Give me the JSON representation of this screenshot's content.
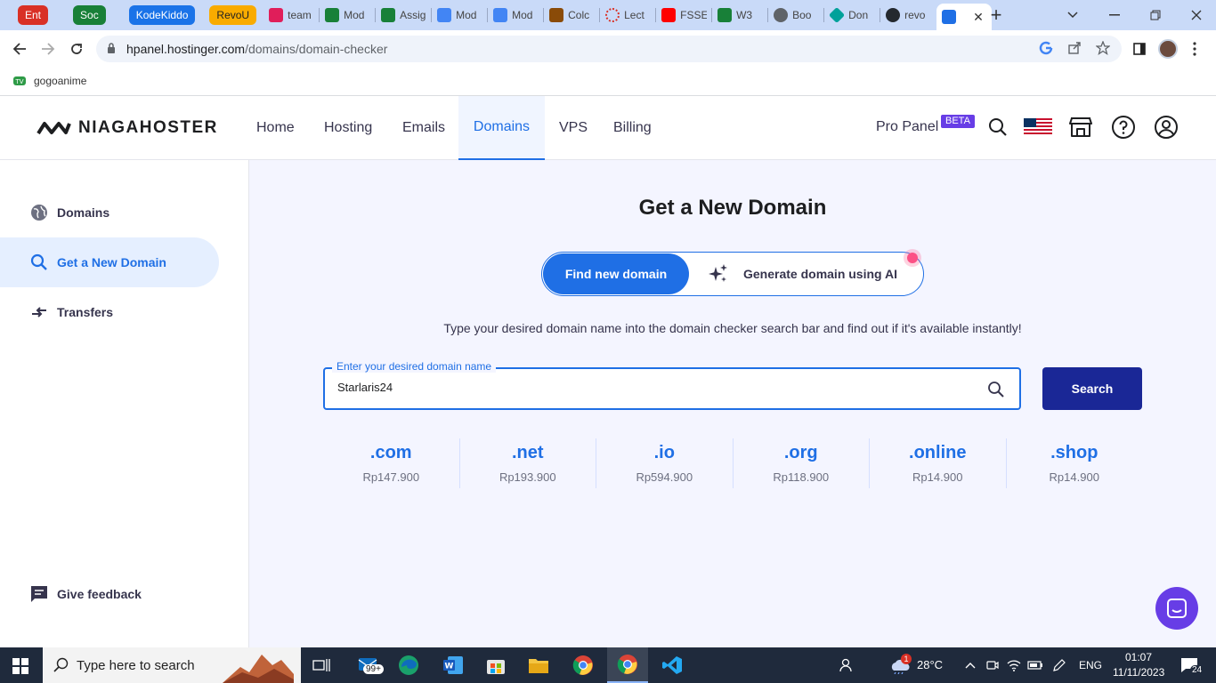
{
  "browser": {
    "groups": [
      {
        "label": "Ent",
        "color": "#d93025"
      },
      {
        "label": "Soc",
        "color": "#188038"
      },
      {
        "label": "KodeKiddo",
        "color": "#1a73e8"
      },
      {
        "label": "RevoU",
        "color": "#f9ab00"
      }
    ],
    "tabs": [
      {
        "title": "team",
        "color": "#e01e5a"
      },
      {
        "title": "Mod",
        "color": "#188038"
      },
      {
        "title": "Assig",
        "color": "#188038"
      },
      {
        "title": "Mod",
        "color": "#4285f4"
      },
      {
        "title": "Mod",
        "color": "#4285f4"
      },
      {
        "title": "Colc",
        "color": "#8a4b08"
      },
      {
        "title": "Lect",
        "color": "#d93025"
      },
      {
        "title": "FSSE",
        "color": "#ff0000"
      },
      {
        "title": "W3",
        "color": "#188038"
      },
      {
        "title": "Boo",
        "color": "#5f6368"
      },
      {
        "title": "Don",
        "color": "#00a19a"
      },
      {
        "title": "revo",
        "color": "#24292f"
      }
    ],
    "url_host": "hpanel.hostinger.com",
    "url_path": "/domains/domain-checker",
    "bookmark": "gogoanime"
  },
  "header": {
    "logo": "NIAGAHOSTER",
    "nav": [
      "Home",
      "Hosting",
      "Emails",
      "Domains",
      "VPS",
      "Billing"
    ],
    "active_nav": "Domains",
    "pro_panel": "Pro Panel",
    "beta": "BETA"
  },
  "sidebar": {
    "items": [
      {
        "label": "Domains",
        "icon": "globe-icon"
      },
      {
        "label": "Get a New Domain",
        "icon": "search-icon"
      },
      {
        "label": "Transfers",
        "icon": "transfer-icon"
      }
    ],
    "feedback": "Give feedback"
  },
  "main": {
    "title": "Get a New Domain",
    "toggle_find": "Find new domain",
    "toggle_ai": "Generate domain using AI",
    "subtitle": "Type your desired domain name into the domain checker search bar and find out if it's available instantly!",
    "field_label": "Enter your desired domain name",
    "field_value": "Starlaris24",
    "search_button": "Search",
    "tlds": [
      {
        "name": ".com",
        "price": "Rp147.900"
      },
      {
        "name": ".net",
        "price": "Rp193.900"
      },
      {
        "name": ".io",
        "price": "Rp594.900"
      },
      {
        "name": ".org",
        "price": "Rp118.900"
      },
      {
        "name": ".online",
        "price": "Rp14.900"
      },
      {
        "name": ".shop",
        "price": "Rp14.900"
      }
    ]
  },
  "taskbar": {
    "search_placeholder": "Type here to search",
    "mail_badge": "99+",
    "weather_badge": "1",
    "temperature": "28°C",
    "language": "ENG",
    "time": "01:07",
    "date": "11/11/2023",
    "notification_count": "24"
  }
}
